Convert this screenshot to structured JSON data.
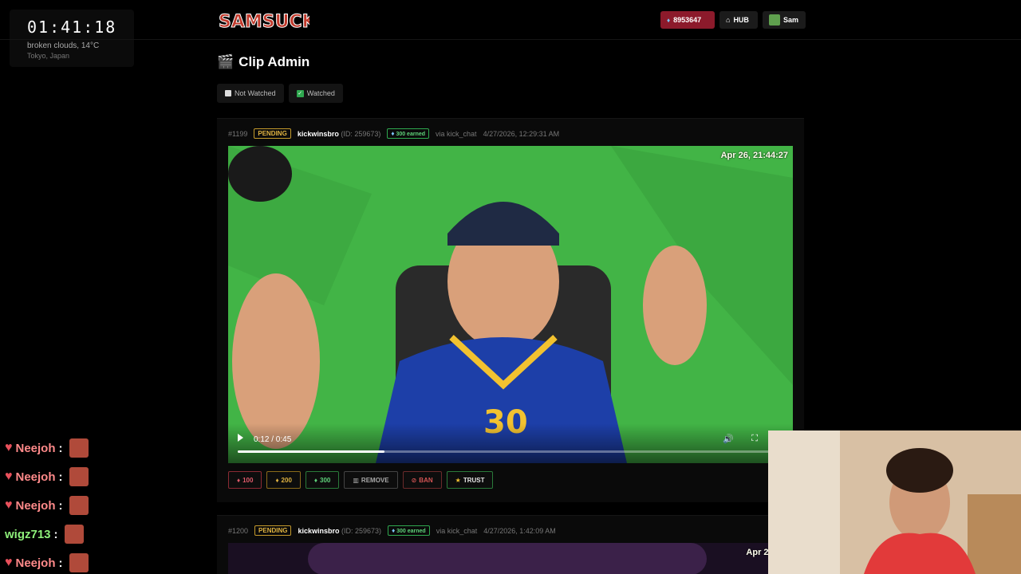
{
  "clock": {
    "time": "01:41:18",
    "weather": "broken clouds, 14°C",
    "location": "Tokyo, Japan"
  },
  "header": {
    "logo_text": "SAMSUCKS",
    "gems": "8953647",
    "hub_label": "HUB",
    "user_label": "Sam"
  },
  "page": {
    "title": "Clip Admin"
  },
  "filters": [
    {
      "label": "Not Watched"
    },
    {
      "label": "Watched"
    }
  ],
  "clips": [
    {
      "id": "#1199",
      "status": "PENDING",
      "user": "kickwinsbro",
      "user_id": "(ID: 259673)",
      "earned": "300 earned",
      "via": "via kick_chat",
      "date": "4/27/2026, 12:29:31 AM",
      "stamp": "Apr 26, 21:44:27",
      "current_time": "0:12 / 0:45",
      "progress": 0.27
    },
    {
      "id": "#1200",
      "status": "PENDING",
      "user": "kickwinsbro",
      "user_id": "(ID: 259673)",
      "earned": "300 earned",
      "via": "via kick_chat",
      "date": "4/27/2026, 1:42:09 AM",
      "stamp": "Apr 26, 23"
    }
  ],
  "actions": {
    "a100": "100",
    "a200": "200",
    "a300": "300",
    "remove": "REMOVE",
    "ban": "BAN",
    "trust": "TRUST"
  },
  "chat": [
    {
      "name": "Neejoh",
      "heart": true
    },
    {
      "name": "Neejoh",
      "heart": true
    },
    {
      "name": "Neejoh",
      "heart": true
    },
    {
      "name": "wigz713",
      "heart": false
    },
    {
      "name": "Neejoh",
      "heart": true
    }
  ],
  "colors": {
    "gem_badge": "#8c1a2b",
    "pending": "#e0b341",
    "earned": "#5fd37b",
    "greenscreen": "#3fae45"
  }
}
